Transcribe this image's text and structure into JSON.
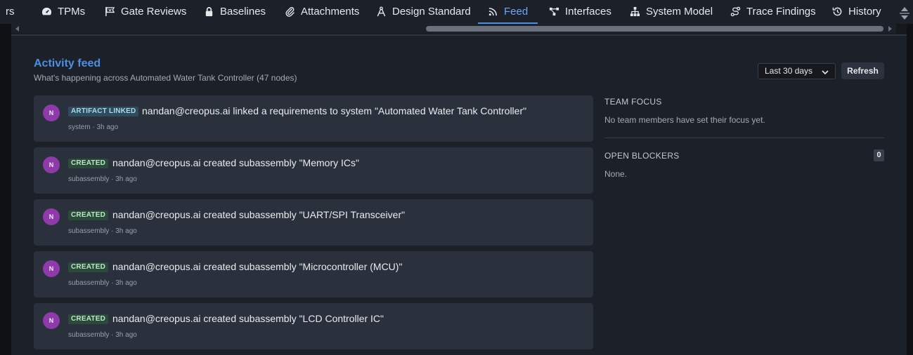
{
  "tabs": [
    {
      "label": "rs",
      "icon": "truncated-tab"
    },
    {
      "label": "TPMs",
      "icon": "gauge-icon"
    },
    {
      "label": "Gate Reviews",
      "icon": "flag-icon"
    },
    {
      "label": "Baselines",
      "icon": "lock-icon"
    },
    {
      "label": "Attachments",
      "icon": "paperclip-icon"
    },
    {
      "label": "Design Standard",
      "icon": "compass-icon"
    },
    {
      "label": "Feed",
      "icon": "rss-icon",
      "active": true
    },
    {
      "label": "Interfaces",
      "icon": "interfaces-icon"
    },
    {
      "label": "System Model",
      "icon": "hierarchy-icon"
    },
    {
      "label": "Trace Findings",
      "icon": "trace-icon"
    },
    {
      "label": "History",
      "icon": "history-icon"
    }
  ],
  "page": {
    "title": "Activity feed",
    "subtitle": "What's happening across Automated Water Tank Controller (47 nodes)",
    "range_value": "Last 30 days",
    "refresh_label": "Refresh"
  },
  "feed": [
    {
      "avatar": "N",
      "badge": "ARTIFACT LINKED",
      "badge_kind": "linked",
      "message": "nandan@creopus.ai linked a requirements to system \"Automated Water Tank Controller\"",
      "meta": "system · 3h ago"
    },
    {
      "avatar": "N",
      "badge": "CREATED",
      "badge_kind": "created",
      "message": "nandan@creopus.ai created subassembly \"Memory ICs\"",
      "meta": "subassembly · 3h ago"
    },
    {
      "avatar": "N",
      "badge": "CREATED",
      "badge_kind": "created",
      "message": "nandan@creopus.ai created subassembly \"UART/SPI Transceiver\"",
      "meta": "subassembly · 3h ago"
    },
    {
      "avatar": "N",
      "badge": "CREATED",
      "badge_kind": "created",
      "message": "nandan@creopus.ai created subassembly \"Microcontroller (MCU)\"",
      "meta": "subassembly · 3h ago"
    },
    {
      "avatar": "N",
      "badge": "CREATED",
      "badge_kind": "created",
      "message": "nandan@creopus.ai created subassembly \"LCD Controller IC\"",
      "meta": "subassembly · 3h ago"
    }
  ],
  "side": {
    "team_focus_heading": "TEAM FOCUS",
    "team_focus_text": "No team members have set their focus yet.",
    "blockers_heading": "OPEN BLOCKERS",
    "blockers_count": "0",
    "blockers_text": "None."
  },
  "colors": {
    "accent": "#4d8fe0",
    "avatar": "#8e3aa8",
    "panel": "#1c2028",
    "card": "#2a303c"
  }
}
